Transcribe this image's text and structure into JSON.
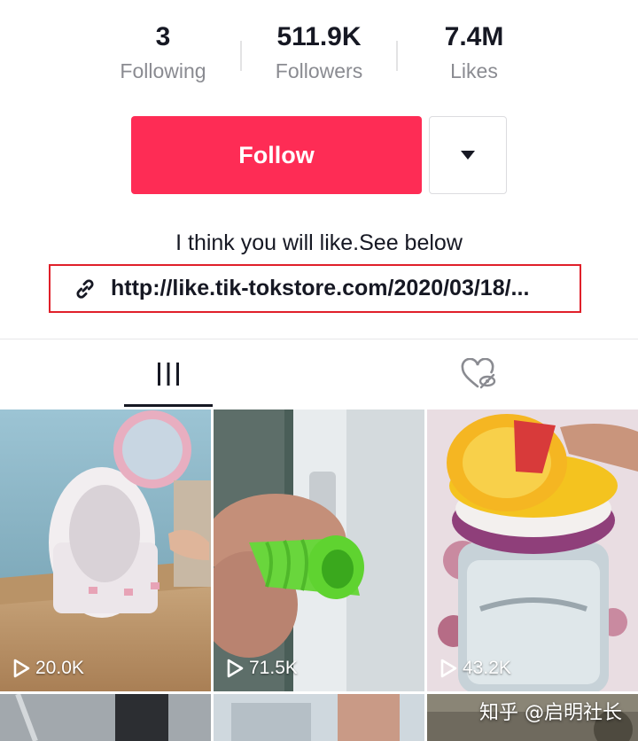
{
  "profile": {
    "stats": [
      {
        "value": "3",
        "label": "Following"
      },
      {
        "value": "511.9K",
        "label": "Followers"
      },
      {
        "value": "7.4M",
        "label": "Likes"
      }
    ],
    "follow_label": "Follow",
    "bio": "I think you will like.See below",
    "link": "http://like.tik-tokstore.com/2020/03/18/..."
  },
  "tabs": [
    {
      "name": "videos",
      "icon": "grid-icon",
      "active": true
    },
    {
      "name": "liked",
      "icon": "heart-hidden-icon",
      "active": false
    }
  ],
  "videos": [
    {
      "plays": "20.0K",
      "subject": "white egg-shaped makeup organizer with ring-light mirror"
    },
    {
      "plays": "71.5K",
      "subject": "green silicone door handle cover"
    },
    {
      "plays": "43.2K",
      "subject": "dried fruit slices on glass water jar"
    }
  ],
  "watermark": "知乎 @启明社长",
  "colors": {
    "accent": "#fe2c55",
    "highlight_box": "#e0202a"
  }
}
